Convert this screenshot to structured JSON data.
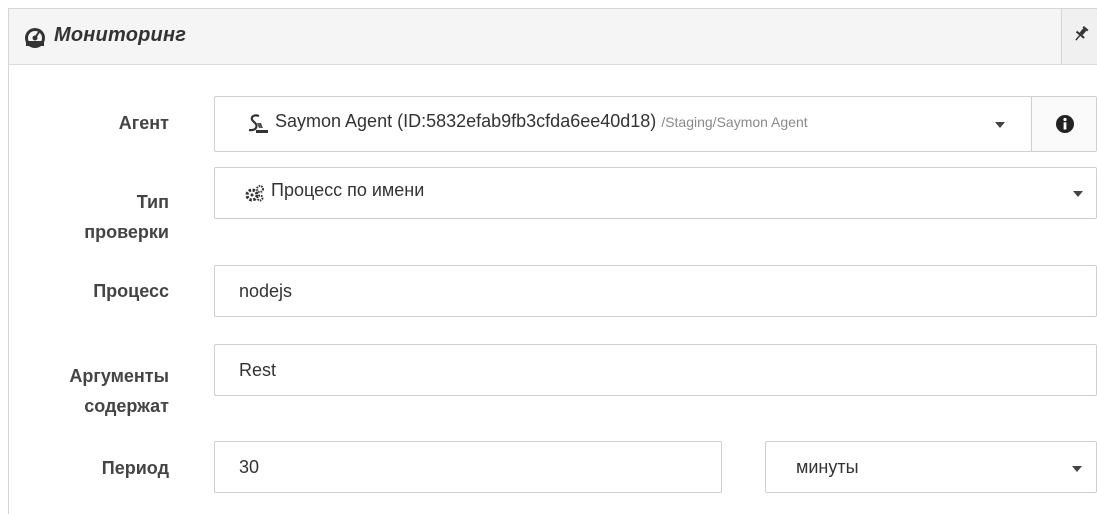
{
  "panel": {
    "title": "Мониторинг",
    "title_icon": "dashboard-icon",
    "pin_icon": "pin-icon"
  },
  "form": {
    "agent": {
      "label": "Агент",
      "icon": "agent-icon",
      "value": "Saymon Agent (ID:5832efab9fb3cfda6ee40d18)",
      "path": "/Staging/Saymon Agent",
      "info_icon": "info-icon"
    },
    "check_type": {
      "label_line1": "Тип",
      "label_line2": "проверки",
      "icon": "gears-icon",
      "value": "Процесс по имени"
    },
    "process": {
      "label": "Процесс",
      "value": "nodejs"
    },
    "args": {
      "label_line1": "Аргументы",
      "label_line2": "содержат",
      "value": "Rest"
    },
    "period": {
      "label": "Период",
      "value": "30",
      "unit": "минуты"
    }
  }
}
